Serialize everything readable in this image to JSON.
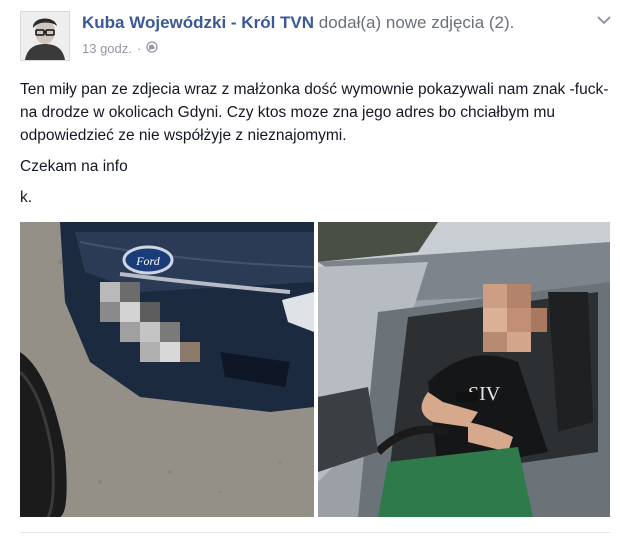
{
  "post": {
    "author": "Kuba Wojewódzki - Król TVN",
    "action": "dodał(a) nowe zdjęcia (2).",
    "timestamp": "13 godz.",
    "separator": "·",
    "privacy_icon": "globe-icon",
    "menu_icon": "chevron-down-icon",
    "paragraphs": [
      "Ten miły pan ze zdjecia wraz z małżonka dość wymownie pokazywali nam znak -fuck- na drodze w okolicach Gdyni. Czy ktos moze zna jego adres bo chciałbym mu odpowiedzieć ze nie współżyje z nieznajomymi.",
      "Czekam na info",
      "k."
    ],
    "photos": [
      {
        "description_icon": "car-front-photo",
        "emblem": "Ford"
      },
      {
        "description_icon": "car-driver-photo",
        "shirt_text": "SIV"
      }
    ],
    "colors": {
      "link": "#3b5998",
      "text": "#141823",
      "muted": "#9197a3"
    }
  }
}
